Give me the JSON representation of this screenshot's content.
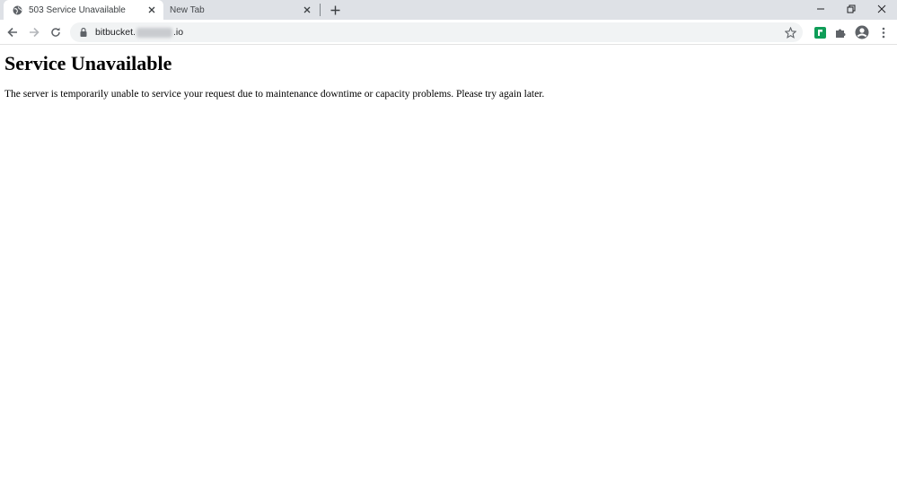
{
  "browser": {
    "tabs": [
      {
        "title": "503 Service Unavailable",
        "active": true,
        "icon": "globe-icon"
      },
      {
        "title": "New Tab",
        "active": false
      }
    ],
    "address_bar": {
      "url_prefix": "bitbucket.",
      "url_suffix": ".io"
    },
    "colors": {
      "tabstrip_bg": "#dee1e6",
      "omnibox_bg": "#f1f3f4",
      "extension_green": "#0f9d58"
    }
  },
  "page": {
    "heading": "Service Unavailable",
    "message": "The server is temporarily unable to service your request due to maintenance downtime or capacity problems. Please try again later."
  }
}
